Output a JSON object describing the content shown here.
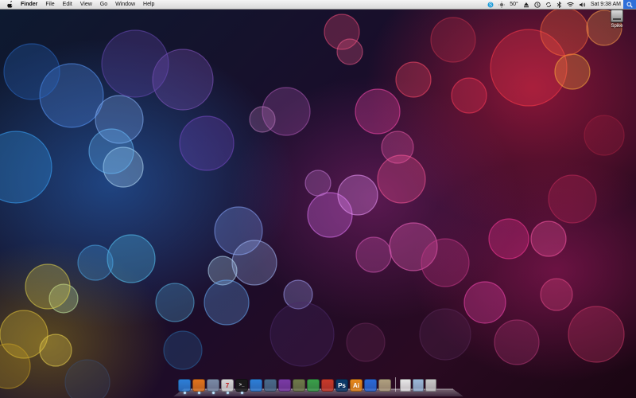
{
  "menubar": {
    "apple_icon": "apple-icon",
    "app_name": "Finder",
    "items": [
      "File",
      "Edit",
      "View",
      "Go",
      "Window",
      "Help"
    ],
    "status": {
      "temperature": "50°",
      "clock": "Sat 9:38 AM",
      "icons": [
        "skype-icon",
        "weather-icon",
        "eject-icon",
        "time-machine-icon",
        "sync-icon",
        "bluetooth-icon",
        "wifi-icon",
        "volume-icon",
        "spotlight-icon"
      ]
    }
  },
  "desktop": {
    "disk": {
      "label": "Spike",
      "icon": "hard-disk-icon"
    }
  },
  "dock": {
    "apps": [
      {
        "name": "finder",
        "glyph": "",
        "color": "#2d7fd8",
        "running": true
      },
      {
        "name": "firefox",
        "glyph": "",
        "color": "#e2741c",
        "running": true
      },
      {
        "name": "preview",
        "glyph": "",
        "color": "#7a8aa6",
        "running": true
      },
      {
        "name": "ical",
        "glyph": "7",
        "color": "#d8d8d8",
        "running": true
      },
      {
        "name": "terminal",
        "glyph": ">_",
        "color": "#1a1a1a",
        "running": true
      },
      {
        "name": "itunes",
        "glyph": "",
        "color": "#2d7fd8",
        "running": false
      },
      {
        "name": "grapher",
        "glyph": "",
        "color": "#4a6a8a",
        "running": false
      },
      {
        "name": "pixelmator",
        "glyph": "",
        "color": "#7a3aa6",
        "running": false
      },
      {
        "name": "script-editor",
        "glyph": "",
        "color": "#6e7a4a",
        "running": false
      },
      {
        "name": "growl",
        "glyph": "",
        "color": "#3aa04a",
        "running": false
      },
      {
        "name": "transmit",
        "glyph": "",
        "color": "#c83a2a",
        "running": false
      },
      {
        "name": "photoshop",
        "glyph": "Ps",
        "color": "#0a3a6a",
        "running": false
      },
      {
        "name": "illustrator",
        "glyph": "Ai",
        "color": "#e8891a",
        "running": false
      },
      {
        "name": "xcode",
        "glyph": "",
        "color": "#2a6ad8",
        "running": false
      },
      {
        "name": "textmate",
        "glyph": "",
        "color": "#b0a080",
        "running": false
      }
    ],
    "stacks": [
      {
        "name": "documents",
        "color": "#e8e8e8"
      },
      {
        "name": "downloads",
        "color": "#9bb8d8"
      },
      {
        "name": "trash",
        "color": "#c8c8c8"
      }
    ]
  }
}
